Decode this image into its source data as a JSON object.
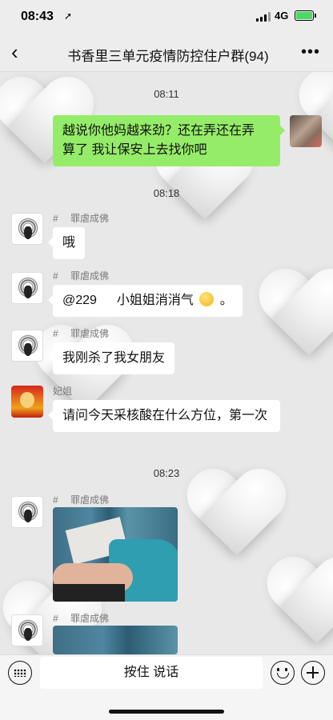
{
  "status_bar": {
    "time": "08:43",
    "location_icon": "location-arrow-icon",
    "network": "4G",
    "battery_color": "#4cd964"
  },
  "header": {
    "back_icon": "chevron-left-icon",
    "title": "书香里三单元疫情防控住户群(94)",
    "more_icon": "more-dots-icon"
  },
  "messages": {
    "ts1": "08:11",
    "m1": {
      "text": "越说你他妈越来劲？还在弄还在弄 算了 我让保安上去找你吧"
    },
    "ts2": "08:18",
    "m2": {
      "nick": "#　 罪虐成佛",
      "text": "哦"
    },
    "m3": {
      "nick": "#　 罪虐成佛",
      "mention": "@229",
      "text": "小姐姐消消气",
      "after": "。"
    },
    "m4": {
      "nick": "#　 罪虐成佛",
      "text": "我刚杀了我女朋友"
    },
    "m5": {
      "nick": "妃姐",
      "text": "请问今天采核酸在什么方位，第一次"
    },
    "ts3": "08:23",
    "m6": {
      "nick": "#　 罪虐成佛"
    },
    "m7": {
      "nick": "#　 罪虐成佛"
    }
  },
  "input_bar": {
    "hold_to_talk": "按住 说话"
  },
  "colors": {
    "sent_bubble": "#95ec69",
    "received_bubble": "#ffffff",
    "background": "#ededed"
  }
}
